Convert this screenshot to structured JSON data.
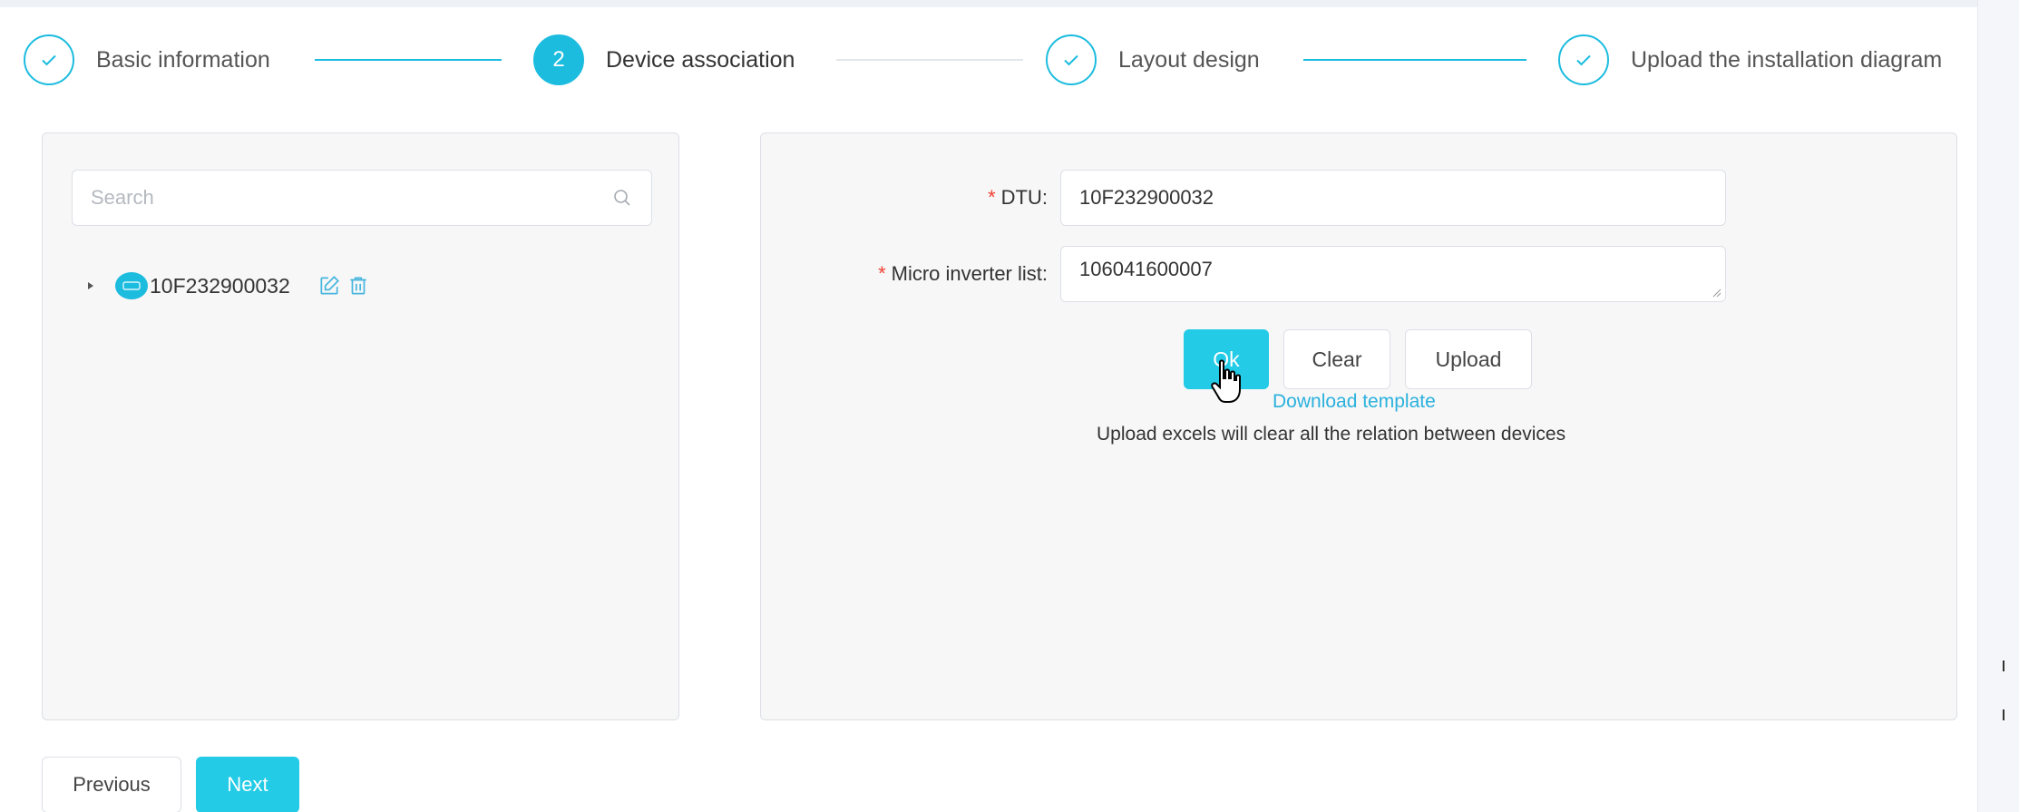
{
  "stepper": {
    "steps": [
      {
        "label": "Basic information",
        "state": "done",
        "marker": "check-icon"
      },
      {
        "label": "Device association",
        "state": "active",
        "number": "2"
      },
      {
        "label": "Layout design",
        "state": "done",
        "marker": "check-icon"
      },
      {
        "label": "Upload the installation diagram",
        "state": "done",
        "marker": "check-icon"
      }
    ]
  },
  "tree": {
    "search_placeholder": "Search",
    "nodes": [
      {
        "label": "10F232900032",
        "expanded": false,
        "icon": "dtu-device-icon",
        "actions": [
          "edit-icon",
          "delete-icon"
        ]
      }
    ]
  },
  "form": {
    "dtu_label": "DTU:",
    "dtu_value": "10F232900032",
    "micro_label": "Micro inverter list:",
    "micro_value": "106041600007",
    "required_mark": "*",
    "ok_label": "Ok",
    "clear_label": "Clear",
    "upload_label": "Upload",
    "download_template": "Download template",
    "upload_note": "Upload excels will clear all the relation between devices"
  },
  "nav": {
    "previous_label": "Previous",
    "next_label": "Next"
  },
  "colors": {
    "accent": "#1cbcdf",
    "button_primary": "#23cbe6",
    "link": "#2ab1dd",
    "required": "#f04134",
    "panel_bg": "#f7f7f7"
  }
}
